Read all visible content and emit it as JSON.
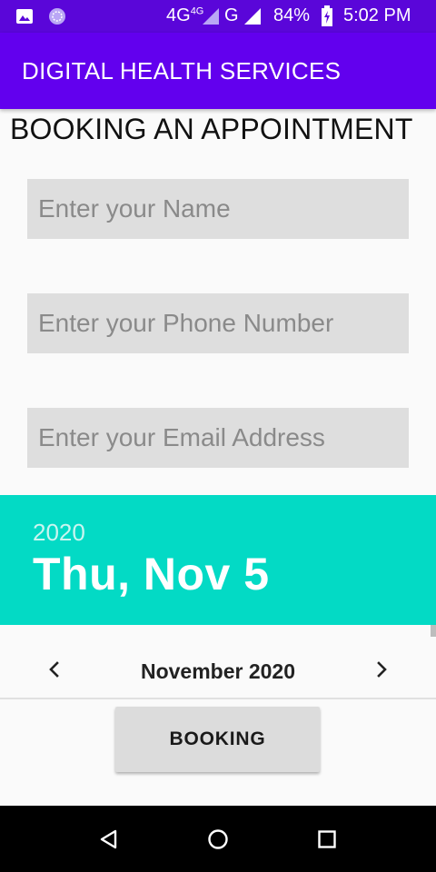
{
  "status_bar": {
    "network": "4G",
    "network_sup": "4G",
    "network2": "G",
    "battery": "84%",
    "time": "5:02 PM",
    "icons": [
      "image-icon",
      "sync-icon",
      "signal-icon",
      "signal-icon",
      "battery-charging-icon"
    ]
  },
  "app_bar": {
    "title": "DIGITAL HEALTH SERVICES",
    "color": "#6200ee"
  },
  "page": {
    "heading": "BOOKING AN APPOINTMENT"
  },
  "form": {
    "name_placeholder": "Enter your Name",
    "phone_placeholder": "Enter your Phone Number",
    "email_placeholder": "Enter your Email Address",
    "name_value": "",
    "phone_value": "",
    "email_value": ""
  },
  "date_picker": {
    "year": "2020",
    "selected_date": "Thu, Nov 5",
    "month": "November 2020",
    "header_color": "#03dac5",
    "prev_icon": "chevron-left-icon",
    "next_icon": "chevron-right-icon"
  },
  "actions": {
    "booking_label": "BOOKING"
  },
  "nav_bar": {
    "icons": [
      "back-icon",
      "home-icon",
      "recents-icon"
    ]
  }
}
